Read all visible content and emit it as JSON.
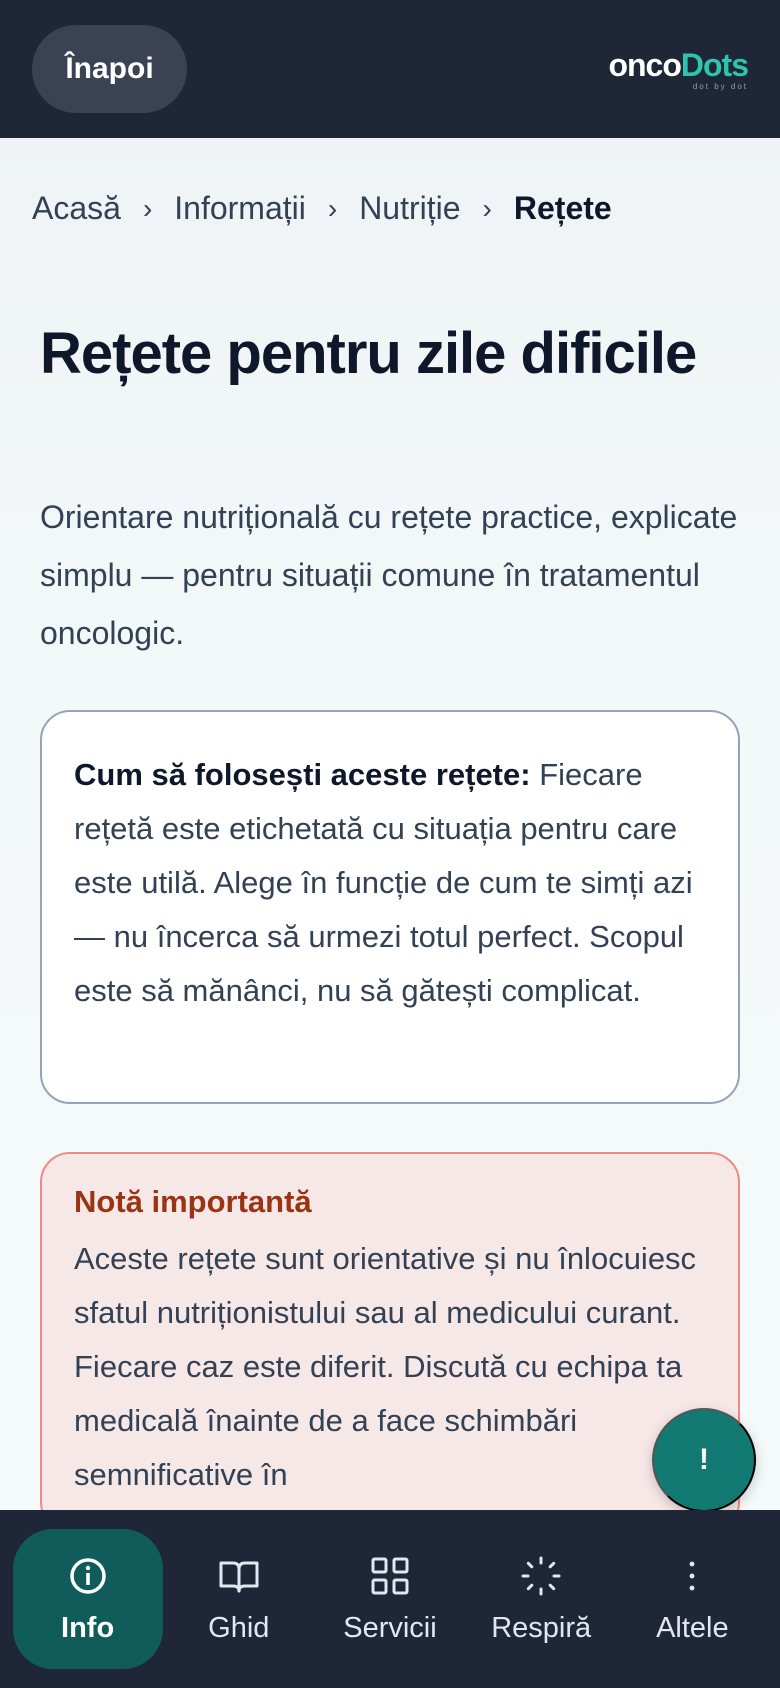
{
  "header": {
    "back_label": "Înapoi",
    "logo": {
      "onco": "onco",
      "dots": "Dots",
      "tagline": "dot by dot"
    }
  },
  "breadcrumb": {
    "items": [
      "Acasă",
      "Informații",
      "Nutriție"
    ],
    "current": "Rețete"
  },
  "page": {
    "title": "Rețete pentru zile dificile",
    "lead": "Orientare nutrițională cu rețete practice, explicate simplu — pentru situații comune în tratamentul oncologic."
  },
  "info_card": {
    "strong": "Cum să folosești aceste rețete:",
    "text": " Fiecare rețetă este etichetată cu situația pentru care este utilă. Alege în funcție de cum te simți azi — nu încerca să urmezi totul perfect. Scopul este să mănânci, nu să gătești complicat."
  },
  "warning_card": {
    "title": "Notă importantă",
    "text": "Aceste rețete sunt orientative și nu înlocuiesc sfatul nutriționistului sau al medicului curant. Fiecare caz este diferit. Discută cu echipa ta medicală înainte de a face schimbări semnificative în"
  },
  "fab": {
    "label": "!"
  },
  "bottom_nav": {
    "items": [
      {
        "label": "Info",
        "icon": "info-icon"
      },
      {
        "label": "Ghid",
        "icon": "book-icon"
      },
      {
        "label": "Servicii",
        "icon": "grid-icon"
      },
      {
        "label": "Respiră",
        "icon": "breath-icon"
      },
      {
        "label": "Altele",
        "icon": "more-icon"
      }
    ]
  },
  "colors": {
    "header_bg": "#1e2638",
    "accent": "#127a73",
    "brand_teal": "#2ec4b0",
    "warning_title": "#9a3412",
    "warning_border": "#ef8a80"
  }
}
